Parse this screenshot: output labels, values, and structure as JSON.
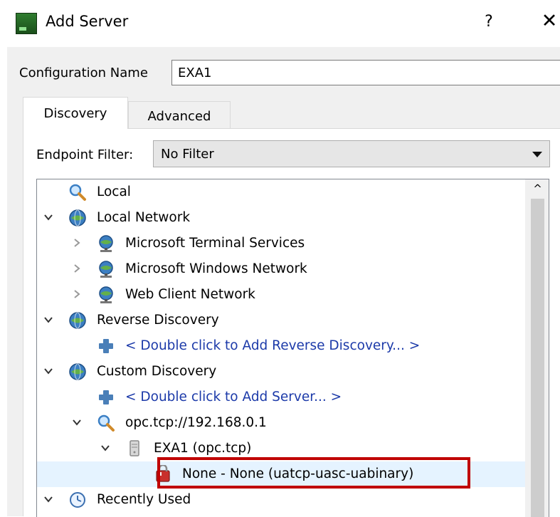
{
  "window": {
    "title": "Add Server",
    "help_label": "?",
    "close_label": "✕",
    "app_icon": "server-app-icon"
  },
  "config": {
    "label": "Configuration Name",
    "value": "EXA1"
  },
  "tabs": [
    {
      "label": "Discovery",
      "active": true
    },
    {
      "label": "Advanced",
      "active": false
    }
  ],
  "endpoint_filter": {
    "label": "Endpoint Filter:",
    "value": "No Filter"
  },
  "tree": {
    "items": [
      {
        "label": "Local",
        "icon": "magnifier-icon",
        "expander": "none"
      },
      {
        "label": "Local Network",
        "icon": "network-globe-icon",
        "expander": "expanded"
      },
      {
        "label": "Microsoft Terminal Services",
        "icon": "network-node-icon",
        "expander": "collapsed"
      },
      {
        "label": "Microsoft Windows Network",
        "icon": "network-node-icon",
        "expander": "collapsed"
      },
      {
        "label": "Web Client Network",
        "icon": "network-node-icon",
        "expander": "collapsed"
      },
      {
        "label": "Reverse Discovery",
        "icon": "network-globe-icon",
        "expander": "expanded"
      },
      {
        "label": "< Double click to Add Reverse Discovery... >",
        "icon": "plus-icon",
        "expander": "none"
      },
      {
        "label": "Custom Discovery",
        "icon": "network-globe-icon",
        "expander": "expanded"
      },
      {
        "label": "< Double click to Add Server... >",
        "icon": "plus-icon",
        "expander": "none"
      },
      {
        "label": "opc.tcp://192.168.0.1",
        "icon": "magnifier-icon",
        "expander": "expanded"
      },
      {
        "label": "EXA1 (opc.tcp)",
        "icon": "server-icon",
        "expander": "expanded"
      },
      {
        "label": "None - None (uatcp-uasc-uabinary)",
        "icon": "endpoint-icon",
        "expander": "none",
        "selected": true
      },
      {
        "label": "Recently Used",
        "icon": "clock-icon",
        "expander": "expanded"
      }
    ]
  },
  "colors": {
    "link": "#1c3aa9",
    "highlight_border": "#c00000",
    "selection": "#e5f3ff"
  }
}
